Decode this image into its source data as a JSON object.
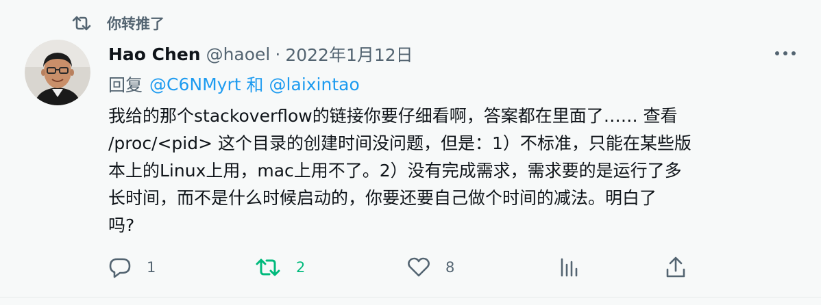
{
  "retweet_context": {
    "label": "你转推了",
    "icon": "retweet-icon"
  },
  "author": {
    "name": "Hao Chen",
    "handle": "@haoel",
    "separator": "·",
    "date": "2022年1月12日",
    "avatar_icon": "avatar"
  },
  "reply": {
    "prefix": "回复",
    "mention_1": "@C6NMyrt",
    "conjunction": "和",
    "mention_2": "@laixintao"
  },
  "tweet": {
    "lines": [
      "我给的那个stackoverflow的链接你要仔细看啊，答案都在里面了…… 查看",
      "/proc/<pid> 这个目录的创建时间没问题，但是：1）不标准，只能在某些版",
      "本上的Linux上用，mac上用不了。2）没有完成需求，需求要的是运行了多",
      "长时间，而不是什么时候启动的，你要还要自己做个时间的减法。明白了",
      "吗?"
    ]
  },
  "actions": {
    "replies": "1",
    "retweets": "2",
    "likes": "8",
    "views": "",
    "share": ""
  },
  "colors": {
    "background": "#f7f9f9",
    "text": "#0f1419",
    "secondary": "#536471",
    "link": "#1d9bf0",
    "retweet_active": "#00ba7c"
  }
}
